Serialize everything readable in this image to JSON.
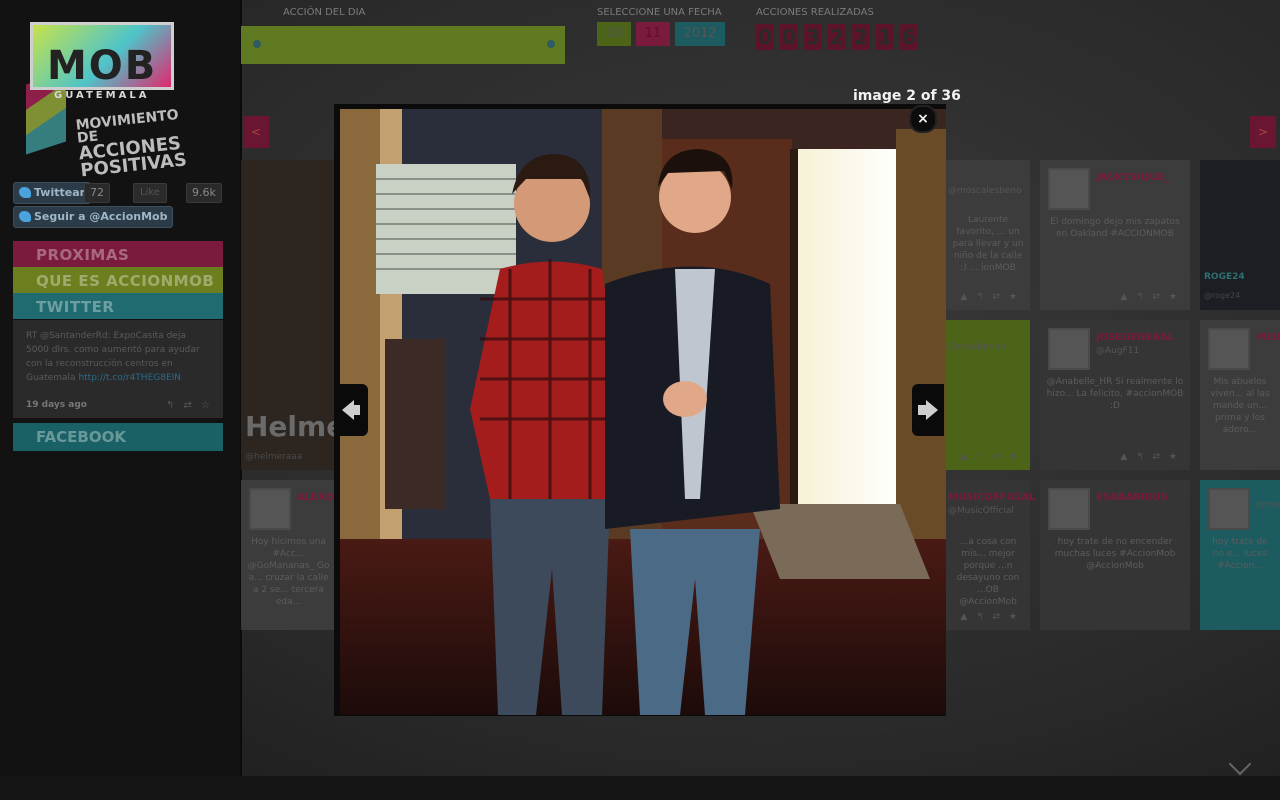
{
  "header": {
    "accion_label": "ACCIÓN DEL DIA",
    "fecha_label": "SELECCIONE UNA FECHA",
    "fecha": {
      "month": "03",
      "day": "11",
      "year": "2012"
    },
    "acciones_label": "ACCIONES REALIZADAS",
    "acciones_digits": [
      "0",
      "0",
      "3",
      "2",
      "2",
      "1",
      "6"
    ]
  },
  "logo": {
    "mob": "MOB",
    "country": "GUATEMALA",
    "tag_line1": "MOVIMIENTO DE",
    "tag_line2": "ACCIONES",
    "tag_line3": "POSITIVAS"
  },
  "social": {
    "tweet_label": "Twittear",
    "tweet_count": "72",
    "like_label": "Like",
    "like_count": "9.6k",
    "follow_label": "Seguir a @AccionMob"
  },
  "menu": {
    "items": [
      "PROXIMAS ACCIONES",
      "QUE ES ACCIONMOB",
      "TWITTER"
    ],
    "facebook": "FACEBOOK"
  },
  "twitter": {
    "text": "RT @SantanderRd: ExpoCasita deja 5000 dlrs. como aumentó para ayudar con la reconstrucción centros en Guatemala",
    "link": "http://t.co/r4THEG8EIN",
    "date": "19 days ago",
    "actions": "↰ ⇄ ☆"
  },
  "cards": [
    {
      "name": "",
      "handle": "@moscalesbeno",
      "text": "Laurente favorito, ... un para llevar y un niño de la calle :) ... ionMOB"
    },
    {
      "name": "JACKYSIQUE_",
      "handle": "",
      "text": "El domingo dejo mis zapatos en Oakland #ACCIONMOB"
    },
    {
      "name": "",
      "handle": "@robalgmbn",
      "text": ""
    },
    {
      "name": "JOSEGENERAL",
      "handle": "@AugF11",
      "text": "@Anabelle_HR Si realmente lo hizo... La felicito, #accionMOB :D"
    },
    {
      "name": "MISH",
      "handle": "",
      "text": "Mis abuelos viven... al las mande un... prima y los adoro..."
    },
    {
      "name": "ALERON",
      "handle": "",
      "text": "Hoy hicimos una #Acc... @GoMananas_ Go a... cruzar la calle a 2 se... tercera eda..."
    },
    {
      "name": "MUSICOFFICIAL",
      "handle": "@MusicOfficial",
      "text": "...a cosa con mis... mejor porque ...n desayuno con ...OB @AccionMob"
    },
    {
      "name": "ESABARRIOS",
      "handle": "",
      "text": "hoy trate de no encender muchas luces #AccionMob @AccionMob"
    },
    {
      "name": "",
      "handle": "@moscale",
      "text": "hoy trate de no e... luces #Accion..."
    }
  ],
  "featured": {
    "name": "Helmer",
    "handle": "@helmeraaa"
  },
  "photo_tags": {
    "right_tag": "ROGE24",
    "right_handle": "@roge24"
  },
  "lightbox": {
    "counter": "image 2 of 36",
    "close": "×"
  },
  "colors": {
    "pink": "#e1286e",
    "green": "#c6e34a",
    "teal": "#4ec4c9"
  }
}
